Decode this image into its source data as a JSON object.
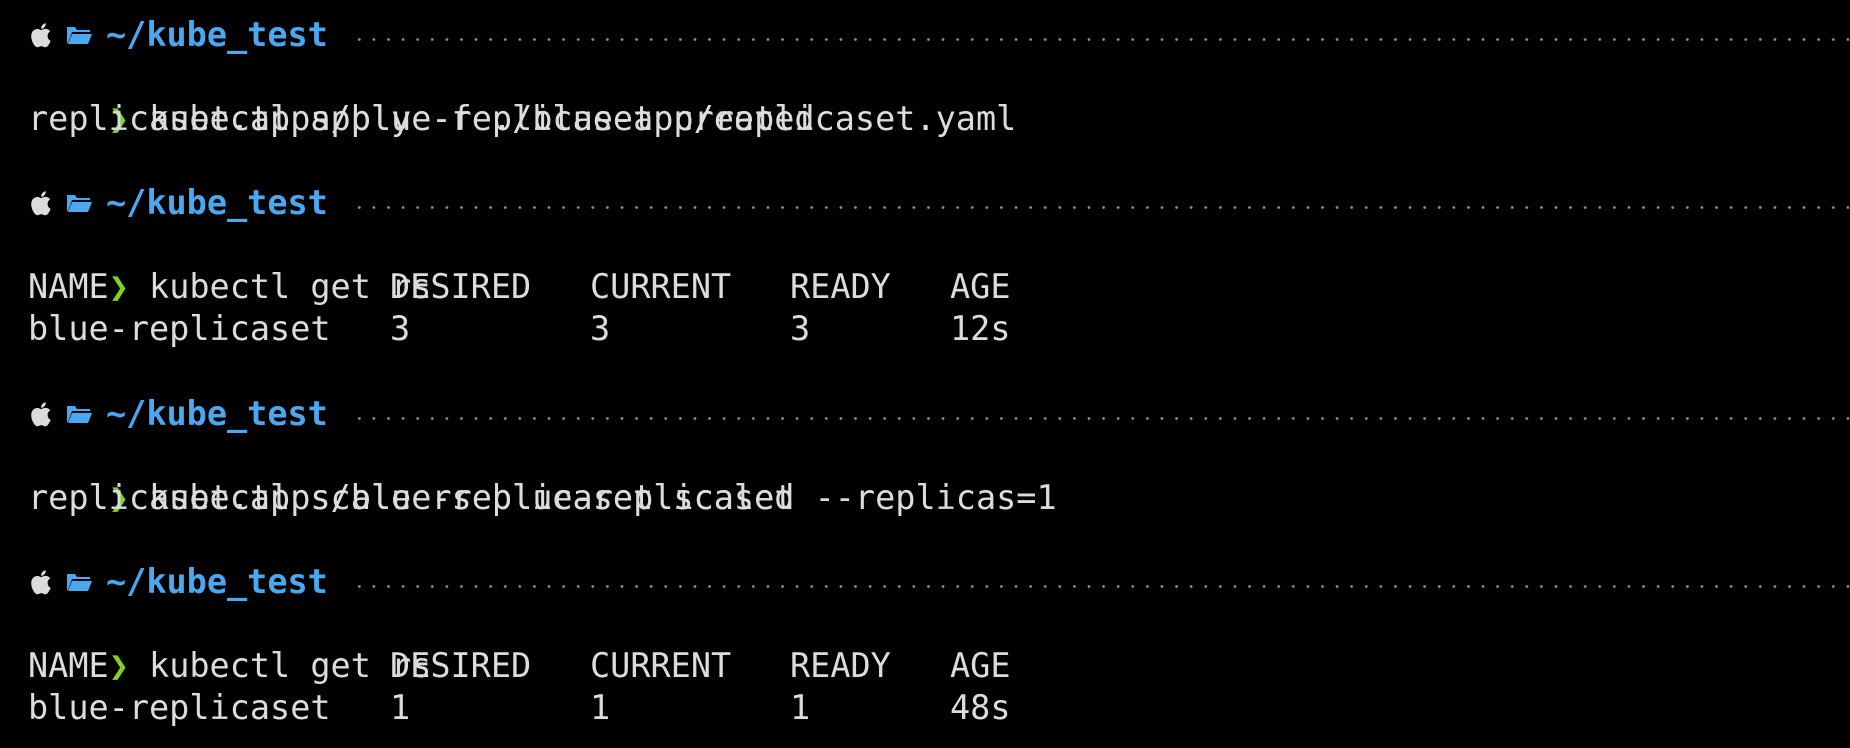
{
  "blocks": [
    {
      "prompt": {
        "path": "~/kube_test"
      },
      "command": {
        "symbol": "❯",
        "text": "kubectl apply -f ./blue-app/replicaset.yaml"
      },
      "output": "replicaset.apps/blue-replicaset created"
    },
    {
      "prompt": {
        "path": "~/kube_test"
      },
      "command": {
        "symbol": "❯",
        "text": "kubectl get rs"
      },
      "table": {
        "headers": [
          "NAME",
          "DESIRED",
          "CURRENT",
          "READY",
          "AGE"
        ],
        "row": [
          "blue-replicaset",
          "3",
          "3",
          "3",
          "12s"
        ]
      }
    },
    {
      "prompt": {
        "path": "~/kube_test"
      },
      "command": {
        "symbol": "❯",
        "text": "kubectl scale rs blue-replicaset --replicas=1"
      },
      "output": "replicaset.apps/blue-replicaset scaled"
    },
    {
      "prompt": {
        "path": "~/kube_test"
      },
      "command": {
        "symbol": "❯",
        "text": "kubectl get rs"
      },
      "table": {
        "headers": [
          "NAME",
          "DESIRED",
          "CURRENT",
          "READY",
          "AGE"
        ],
        "row": [
          "blue-replicaset",
          "1",
          "1",
          "1",
          "48s"
        ]
      }
    }
  ],
  "icons": {
    "os": "apple-icon",
    "directory": "folder-icon"
  },
  "colors": {
    "background": "#000000",
    "text": "#dcdcdc",
    "path": "#4aa8f0",
    "chevron": "#7ed321",
    "dots": "#8a8a8a"
  }
}
